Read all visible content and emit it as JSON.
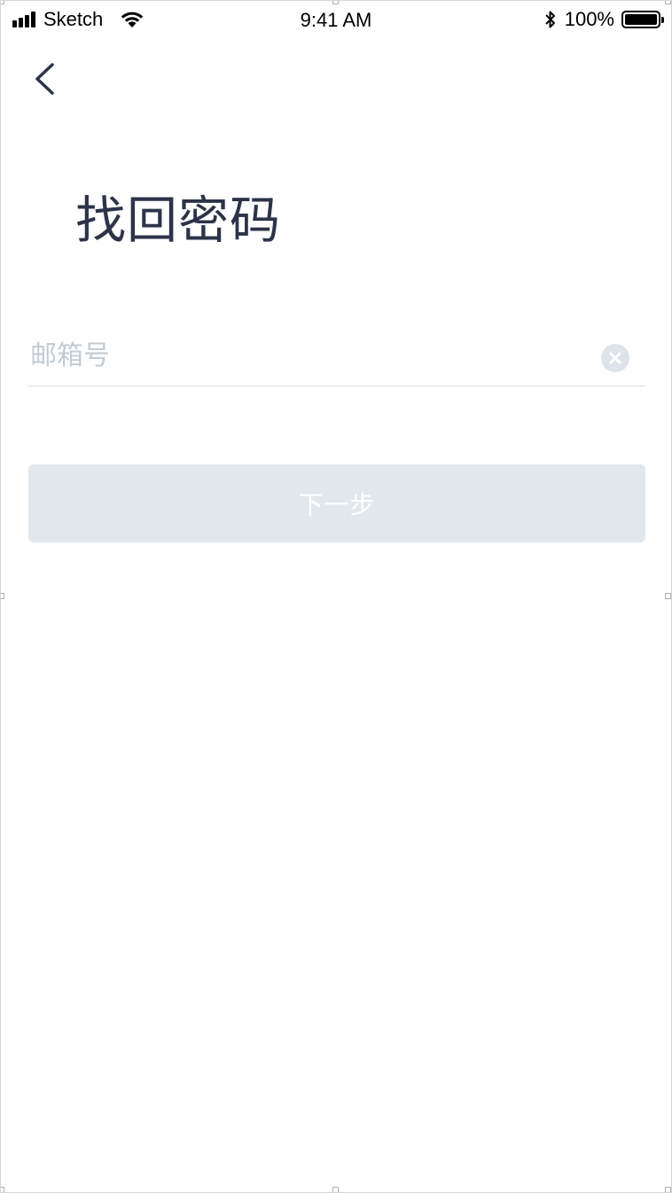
{
  "status_bar": {
    "carrier": "Sketch",
    "time": "9:41 AM",
    "battery_percent": "100%",
    "battery_level": 1.0,
    "icons": [
      "signal-icon",
      "wifi-icon",
      "bluetooth-icon",
      "battery-icon"
    ]
  },
  "nav": {
    "back_icon": "chevron-left-icon"
  },
  "page": {
    "title": "找回密码"
  },
  "form": {
    "email": {
      "placeholder": "邮箱号",
      "value": "",
      "clear_icon": "clear-circle-icon"
    },
    "next_label": "下一步"
  },
  "colors": {
    "title": "#2d3448",
    "placeholder": "#c3cbd3",
    "divider": "#dcdfe3",
    "button_disabled_bg": "#e1e7eb",
    "button_text": "#ffffff",
    "clear_icon": "#dde3e8"
  }
}
